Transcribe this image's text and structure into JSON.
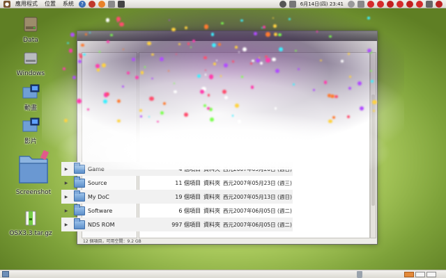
{
  "top_panel": {
    "menus": [
      "應用程式",
      "位置",
      "系統"
    ],
    "clock": "6月14日(四) 23:41"
  },
  "desktop": {
    "icons": [
      {
        "label": "Data",
        "icon": "drive-icon"
      },
      {
        "label": "Windows",
        "icon": "drive-icon"
      },
      {
        "label": "動畫",
        "icon": "movie-folder-icon"
      },
      {
        "label": "影片",
        "icon": "movie-folder-icon"
      },
      {
        "label": "Screenshot",
        "icon": "folder-icon"
      },
      {
        "label": "OSX3.3.tar.gz",
        "icon": "archive-icon"
      }
    ]
  },
  "file_window": {
    "rows": [
      {
        "name": "Game",
        "size": "4 個項目",
        "type": "資料夾",
        "date": "西元2007年05月20日 (週日) 14"
      },
      {
        "name": "Source",
        "size": "11 個項目",
        "type": "資料夾",
        "date": "西元2007年05月23日 (週三) 11"
      },
      {
        "name": "My DoC",
        "size": "19 個項目",
        "type": "資料夾",
        "date": "西元2007年05月13日 (週日) 11"
      },
      {
        "name": "Software",
        "size": "6 個項目",
        "type": "資料夾",
        "date": "西元2007年06月05日 (週二) 09"
      },
      {
        "name": "NDS ROM",
        "size": "997 個項目",
        "type": "資料夾",
        "date": "西元2007年06月05日 (週二) 11"
      }
    ],
    "status": "12 個項目，可用空間：9.2 GB"
  },
  "colors": {
    "folder": "#5d8fc9",
    "panel": "#dcdad3"
  }
}
